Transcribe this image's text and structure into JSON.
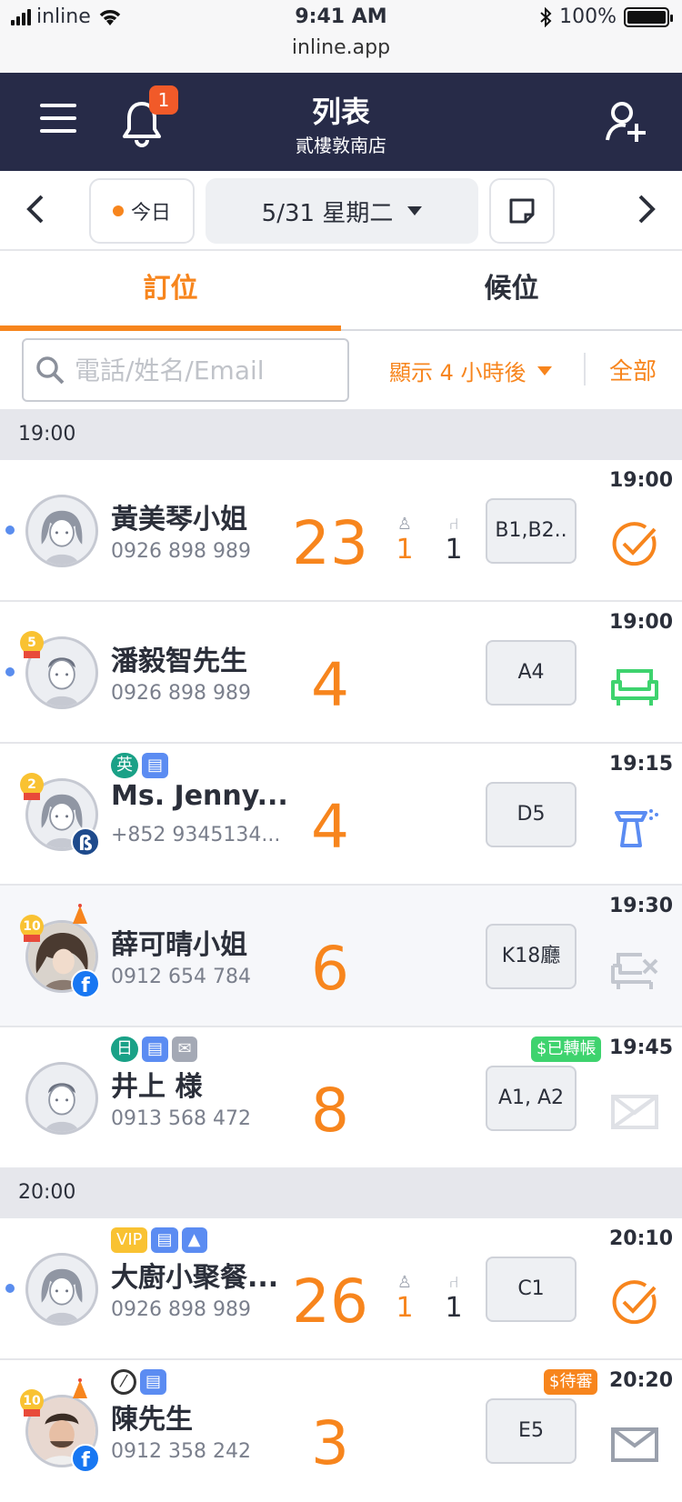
{
  "status_bar": {
    "carrier": "inline",
    "time": "9:41 AM",
    "battery": "100%",
    "url": "inline.app"
  },
  "nav": {
    "title": "列表",
    "subtitle": "貳樓敦南店",
    "notification_count": "1"
  },
  "date_bar": {
    "today_label": "今日",
    "date_label": "5/31 星期二"
  },
  "tabs": [
    {
      "label": "訂位"
    },
    {
      "label": "候位"
    }
  ],
  "filter": {
    "search_placeholder": "電話/姓名/Email",
    "show_label": "顯示 4 小時後",
    "all_label": "全部"
  },
  "groups": [
    {
      "time": "19:00"
    },
    {
      "time": "20:00"
    }
  ],
  "reservations": [
    {
      "name": "黃美琴小姐",
      "phone": "0926 898 989",
      "party": "23",
      "kids": "1",
      "chairs": "1",
      "table": "B1,B2..",
      "time": "19:00",
      "status": "checked"
    },
    {
      "name": "潘毅智先生",
      "phone": "0926 898 989",
      "party": "4",
      "rank": "5",
      "table": "A4",
      "time": "19:00",
      "status": "seated"
    },
    {
      "name": "Ms. Jenny...",
      "phone": "+852 9345134...",
      "party": "4",
      "rank": "2",
      "tags": [
        "英"
      ],
      "table": "D5",
      "time": "19:15",
      "status": "cleaning"
    },
    {
      "name": "薛可晴小姐",
      "phone": "0912 654 784",
      "party": "6",
      "rank": "10",
      "table": "K18廳",
      "time": "19:30",
      "status": "no-show"
    },
    {
      "name": "井上 様",
      "phone": "0913 568 472",
      "party": "8",
      "tags": [
        "日"
      ],
      "table": "A1, A2",
      "time": "19:45",
      "status": "mail-fail",
      "payment": "$已轉帳"
    },
    {
      "name": "大廚小聚餐...",
      "phone": "0926 898 989",
      "party": "26",
      "kids": "1",
      "chairs": "1",
      "tags": [
        "VIP"
      ],
      "table": "C1",
      "time": "20:10",
      "status": "checked"
    },
    {
      "name": "陳先生",
      "phone": "0912 358 242",
      "party": "3",
      "rank": "10",
      "table": "E5",
      "time": "20:20",
      "status": "mail",
      "payment": "$待審"
    }
  ]
}
